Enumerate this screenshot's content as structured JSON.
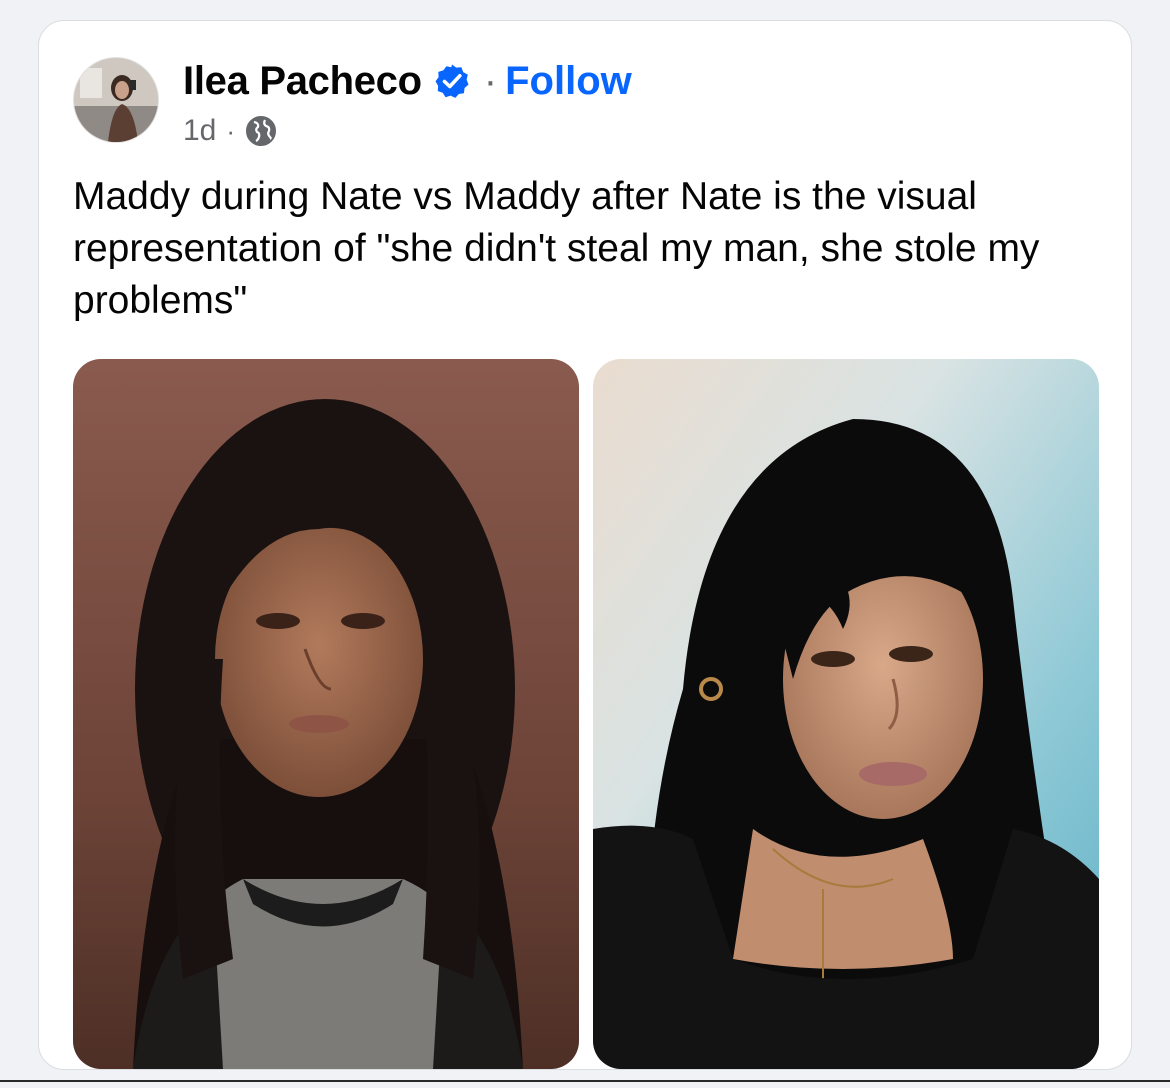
{
  "post": {
    "author": {
      "name": "Ilea Pacheco",
      "verified": true,
      "avatar_icon": "avatar-photo"
    },
    "separator": "·",
    "follow_label": "Follow",
    "timestamp": "1d",
    "meta_separator": "·",
    "audience_icon": "globe-icon",
    "caption": "Maddy during Nate vs Maddy after Nate is the visual representation of \"she didn't steal my man, she stole my problems\"",
    "photos": [
      {
        "name": "photo-left",
        "description_icon": "photo"
      },
      {
        "name": "photo-right",
        "description_icon": "photo"
      }
    ]
  },
  "colors": {
    "accent": "#0866ff",
    "text_primary": "#050505",
    "text_secondary": "#65676b",
    "card_bg": "#ffffff"
  }
}
